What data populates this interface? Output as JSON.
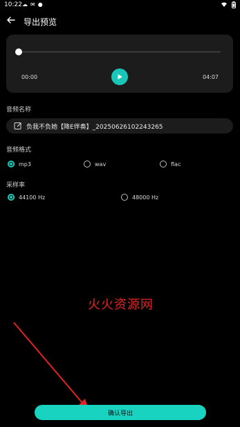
{
  "status_bar": {
    "time": "10:22",
    "left_icons": [
      "cloud-icon",
      "chat-icon",
      "notification-icon"
    ],
    "right_icons": [
      "wifi-icon",
      "battery-icon"
    ]
  },
  "header": {
    "title": "导出预览",
    "back_icon": "arrow-left-icon"
  },
  "player": {
    "current_time": "00:00",
    "total_time": "04:07",
    "progress_fraction": 0,
    "play_icon": "play-icon",
    "accent_color": "#19C6B8"
  },
  "filename": {
    "label": "音频名称",
    "value": "负我不负她【降E伴奏】_20250626102243265",
    "edit_icon": "edit-icon"
  },
  "format": {
    "label": "音频格式",
    "options": [
      "mp3",
      "wav",
      "flac"
    ],
    "selected": "mp3"
  },
  "sample_rate": {
    "label": "采样率",
    "options": [
      "44100 Hz",
      "48000 Hz"
    ],
    "selected": "44100 Hz"
  },
  "watermark_text": "火火资源网",
  "annotation": {
    "arrow_color": "#E32222"
  },
  "confirm_button": {
    "label": "确认导出",
    "color": "#17D3C0"
  }
}
